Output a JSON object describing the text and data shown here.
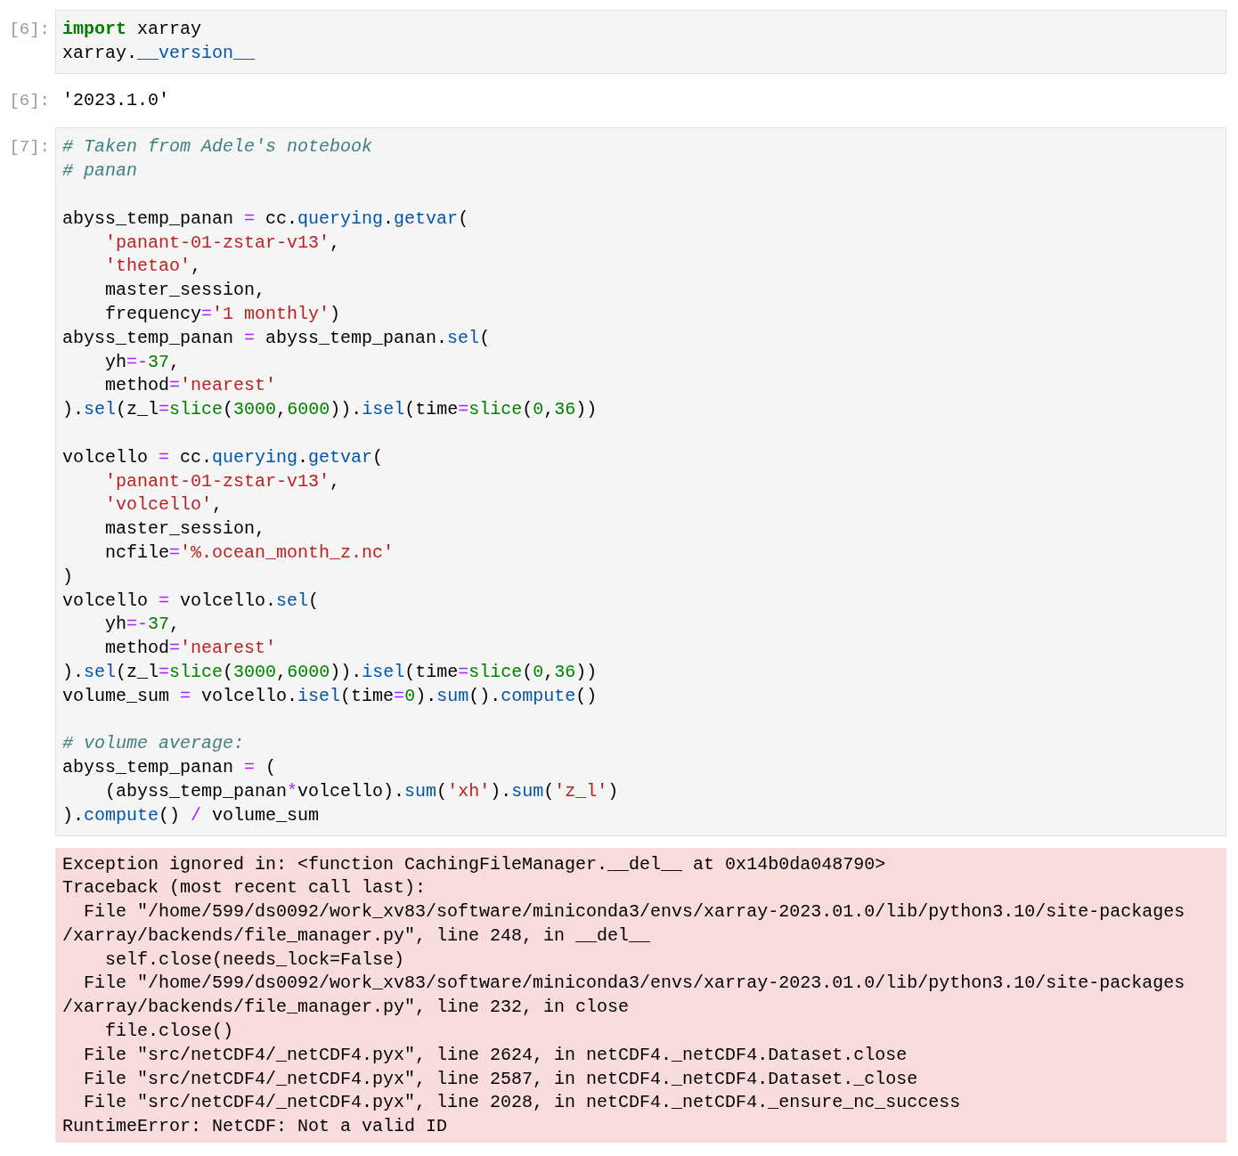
{
  "cells": [
    {
      "kind": "code",
      "prompt": "[6]:",
      "lines": [
        {
          "kind": "code",
          "tokens": [
            {
              "kind": "kw",
              "text": "import"
            },
            {
              "kind": "n",
              "text": " xarray"
            }
          ]
        },
        {
          "kind": "code",
          "tokens": [
            {
              "kind": "n",
              "text": "xarray."
            },
            {
              "kind": "attr",
              "text": "__version__"
            }
          ]
        }
      ]
    },
    {
      "kind": "result",
      "prompt": "[6]:",
      "text": "'2023.1.0'"
    },
    {
      "kind": "code",
      "prompt": "[7]:",
      "lines": [
        {
          "kind": "code",
          "tokens": [
            {
              "kind": "comment",
              "text": "# Taken from Adele's notebook"
            }
          ]
        },
        {
          "kind": "code",
          "tokens": [
            {
              "kind": "comment",
              "text": "# panan"
            }
          ]
        },
        {
          "kind": "blank"
        },
        {
          "kind": "code",
          "tokens": [
            {
              "kind": "n",
              "text": "abyss_temp_panan "
            },
            {
              "kind": "op",
              "text": "="
            },
            {
              "kind": "n",
              "text": " cc."
            },
            {
              "kind": "attr",
              "text": "querying"
            },
            {
              "kind": "n",
              "text": "."
            },
            {
              "kind": "attr",
              "text": "getvar"
            },
            {
              "kind": "n",
              "text": "("
            }
          ]
        },
        {
          "kind": "code",
          "tokens": [
            {
              "kind": "str",
              "text": "    'panant-01-zstar-v13'"
            },
            {
              "kind": "n",
              "text": ","
            }
          ]
        },
        {
          "kind": "code",
          "tokens": [
            {
              "kind": "str",
              "text": "    'thetao'"
            },
            {
              "kind": "n",
              "text": ","
            }
          ]
        },
        {
          "kind": "code",
          "tokens": [
            {
              "kind": "n",
              "text": "    master_session,"
            }
          ]
        },
        {
          "kind": "code",
          "tokens": [
            {
              "kind": "n",
              "text": "    frequency"
            },
            {
              "kind": "op",
              "text": "="
            },
            {
              "kind": "str",
              "text": "'1 monthly'"
            },
            {
              "kind": "n",
              "text": ")"
            }
          ]
        },
        {
          "kind": "code",
          "tokens": [
            {
              "kind": "n",
              "text": "abyss_temp_panan "
            },
            {
              "kind": "op",
              "text": "="
            },
            {
              "kind": "n",
              "text": " abyss_temp_panan."
            },
            {
              "kind": "attr",
              "text": "sel"
            },
            {
              "kind": "n",
              "text": "("
            }
          ]
        },
        {
          "kind": "code",
          "tokens": [
            {
              "kind": "n",
              "text": "    yh"
            },
            {
              "kind": "op",
              "text": "=-"
            },
            {
              "kind": "num",
              "text": "37"
            },
            {
              "kind": "n",
              "text": ","
            }
          ]
        },
        {
          "kind": "code",
          "tokens": [
            {
              "kind": "n",
              "text": "    method"
            },
            {
              "kind": "op",
              "text": "="
            },
            {
              "kind": "str",
              "text": "'nearest'"
            }
          ]
        },
        {
          "kind": "code",
          "tokens": [
            {
              "kind": "n",
              "text": ")."
            },
            {
              "kind": "attr",
              "text": "sel"
            },
            {
              "kind": "n",
              "text": "(z_l"
            },
            {
              "kind": "op",
              "text": "="
            },
            {
              "kind": "bi",
              "text": "slice"
            },
            {
              "kind": "n",
              "text": "("
            },
            {
              "kind": "num",
              "text": "3000"
            },
            {
              "kind": "n",
              "text": ","
            },
            {
              "kind": "num",
              "text": "6000"
            },
            {
              "kind": "n",
              "text": "))."
            },
            {
              "kind": "attr",
              "text": "isel"
            },
            {
              "kind": "n",
              "text": "(time"
            },
            {
              "kind": "op",
              "text": "="
            },
            {
              "kind": "bi",
              "text": "slice"
            },
            {
              "kind": "n",
              "text": "("
            },
            {
              "kind": "num",
              "text": "0"
            },
            {
              "kind": "n",
              "text": ","
            },
            {
              "kind": "num",
              "text": "36"
            },
            {
              "kind": "n",
              "text": "))"
            }
          ]
        },
        {
          "kind": "blank"
        },
        {
          "kind": "code",
          "tokens": [
            {
              "kind": "n",
              "text": "volcello "
            },
            {
              "kind": "op",
              "text": "="
            },
            {
              "kind": "n",
              "text": " cc."
            },
            {
              "kind": "attr",
              "text": "querying"
            },
            {
              "kind": "n",
              "text": "."
            },
            {
              "kind": "attr",
              "text": "getvar"
            },
            {
              "kind": "n",
              "text": "("
            }
          ]
        },
        {
          "kind": "code",
          "tokens": [
            {
              "kind": "str",
              "text": "    'panant-01-zstar-v13'"
            },
            {
              "kind": "n",
              "text": ","
            }
          ]
        },
        {
          "kind": "code",
          "tokens": [
            {
              "kind": "str",
              "text": "    'volcello'"
            },
            {
              "kind": "n",
              "text": ","
            }
          ]
        },
        {
          "kind": "code",
          "tokens": [
            {
              "kind": "n",
              "text": "    master_session,"
            }
          ]
        },
        {
          "kind": "code",
          "tokens": [
            {
              "kind": "n",
              "text": "    ncfile"
            },
            {
              "kind": "op",
              "text": "="
            },
            {
              "kind": "str",
              "text": "'%.ocean_month_z.nc'"
            }
          ]
        },
        {
          "kind": "code",
          "tokens": [
            {
              "kind": "n",
              "text": ")"
            }
          ]
        },
        {
          "kind": "code",
          "tokens": [
            {
              "kind": "n",
              "text": "volcello "
            },
            {
              "kind": "op",
              "text": "="
            },
            {
              "kind": "n",
              "text": " volcello."
            },
            {
              "kind": "attr",
              "text": "sel"
            },
            {
              "kind": "n",
              "text": "("
            }
          ]
        },
        {
          "kind": "code",
          "tokens": [
            {
              "kind": "n",
              "text": "    yh"
            },
            {
              "kind": "op",
              "text": "=-"
            },
            {
              "kind": "num",
              "text": "37"
            },
            {
              "kind": "n",
              "text": ","
            }
          ]
        },
        {
          "kind": "code",
          "tokens": [
            {
              "kind": "n",
              "text": "    method"
            },
            {
              "kind": "op",
              "text": "="
            },
            {
              "kind": "str",
              "text": "'nearest'"
            }
          ]
        },
        {
          "kind": "code",
          "tokens": [
            {
              "kind": "n",
              "text": ")."
            },
            {
              "kind": "attr",
              "text": "sel"
            },
            {
              "kind": "n",
              "text": "(z_l"
            },
            {
              "kind": "op",
              "text": "="
            },
            {
              "kind": "bi",
              "text": "slice"
            },
            {
              "kind": "n",
              "text": "("
            },
            {
              "kind": "num",
              "text": "3000"
            },
            {
              "kind": "n",
              "text": ","
            },
            {
              "kind": "num",
              "text": "6000"
            },
            {
              "kind": "n",
              "text": "))."
            },
            {
              "kind": "attr",
              "text": "isel"
            },
            {
              "kind": "n",
              "text": "(time"
            },
            {
              "kind": "op",
              "text": "="
            },
            {
              "kind": "bi",
              "text": "slice"
            },
            {
              "kind": "n",
              "text": "("
            },
            {
              "kind": "num",
              "text": "0"
            },
            {
              "kind": "n",
              "text": ","
            },
            {
              "kind": "num",
              "text": "36"
            },
            {
              "kind": "n",
              "text": "))"
            }
          ]
        },
        {
          "kind": "code",
          "tokens": [
            {
              "kind": "n",
              "text": "volume_sum "
            },
            {
              "kind": "op",
              "text": "="
            },
            {
              "kind": "n",
              "text": " volcello."
            },
            {
              "kind": "attr",
              "text": "isel"
            },
            {
              "kind": "n",
              "text": "(time"
            },
            {
              "kind": "op",
              "text": "="
            },
            {
              "kind": "num",
              "text": "0"
            },
            {
              "kind": "n",
              "text": ")."
            },
            {
              "kind": "attr",
              "text": "sum"
            },
            {
              "kind": "n",
              "text": "()."
            },
            {
              "kind": "attr",
              "text": "compute"
            },
            {
              "kind": "n",
              "text": "()"
            }
          ]
        },
        {
          "kind": "blank"
        },
        {
          "kind": "code",
          "tokens": [
            {
              "kind": "comment",
              "text": "# volume average:"
            }
          ]
        },
        {
          "kind": "code",
          "tokens": [
            {
              "kind": "n",
              "text": "abyss_temp_panan "
            },
            {
              "kind": "op",
              "text": "="
            },
            {
              "kind": "n",
              "text": " ("
            }
          ]
        },
        {
          "kind": "code",
          "tokens": [
            {
              "kind": "n",
              "text": "    (abyss_temp_panan"
            },
            {
              "kind": "op",
              "text": "*"
            },
            {
              "kind": "n",
              "text": "volcello)."
            },
            {
              "kind": "attr",
              "text": "sum"
            },
            {
              "kind": "n",
              "text": "("
            },
            {
              "kind": "str",
              "text": "'xh'"
            },
            {
              "kind": "n",
              "text": ")."
            },
            {
              "kind": "attr",
              "text": "sum"
            },
            {
              "kind": "n",
              "text": "("
            },
            {
              "kind": "str",
              "text": "'z_l'"
            },
            {
              "kind": "n",
              "text": ")"
            }
          ]
        },
        {
          "kind": "code",
          "tokens": [
            {
              "kind": "n",
              "text": ")."
            },
            {
              "kind": "attr",
              "text": "compute"
            },
            {
              "kind": "n",
              "text": "() "
            },
            {
              "kind": "op",
              "text": "/"
            },
            {
              "kind": "n",
              "text": " volume_sum"
            }
          ]
        }
      ]
    },
    {
      "kind": "error",
      "lines": [
        "Exception ignored in: <function CachingFileManager.__del__ at 0x14b0da048790>",
        "Traceback (most recent call last):",
        "  File \"/home/599/ds0092/work_xv83/software/miniconda3/envs/xarray-2023.01.0/lib/python3.10/site-packages",
        "/xarray/backends/file_manager.py\", line 248, in __del__",
        "    self.close(needs_lock=False)",
        "  File \"/home/599/ds0092/work_xv83/software/miniconda3/envs/xarray-2023.01.0/lib/python3.10/site-packages",
        "/xarray/backends/file_manager.py\", line 232, in close",
        "    file.close()",
        "  File \"src/netCDF4/_netCDF4.pyx\", line 2624, in netCDF4._netCDF4.Dataset.close",
        "  File \"src/netCDF4/_netCDF4.pyx\", line 2587, in netCDF4._netCDF4.Dataset._close",
        "  File \"src/netCDF4/_netCDF4.pyx\", line 2028, in netCDF4._netCDF4._ensure_nc_success",
        "RuntimeError: NetCDF: Not a valid ID"
      ]
    }
  ]
}
